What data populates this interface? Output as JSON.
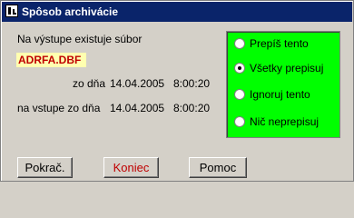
{
  "window": {
    "title": "Spôsob archivácie"
  },
  "info": {
    "line1": "Na výstupe existuje súbor",
    "filename": "ADRFA.DBF",
    "line2_prefix": "zo dňa",
    "line2_date": "14.04.2005",
    "line2_time": "8:00:20",
    "line3_prefix": "na vstupe zo dňa",
    "line3_date": "14.04.2005",
    "line3_time": "8:00:20"
  },
  "options": [
    {
      "label": "Prepíš tento",
      "selected": false
    },
    {
      "label": "Všetky prepisuj",
      "selected": true
    },
    {
      "label": "Ignoruj tento",
      "selected": false
    },
    {
      "label": "Nič neprepisuj",
      "selected": false
    }
  ],
  "buttons": {
    "continue": "Pokrač.",
    "end": "Koniec",
    "help": "Pomoc"
  },
  "colors": {
    "titlebar": "#0a246a",
    "options_bg": "#00ff00",
    "filename_text": "#c00000",
    "end_text": "#c00000"
  }
}
